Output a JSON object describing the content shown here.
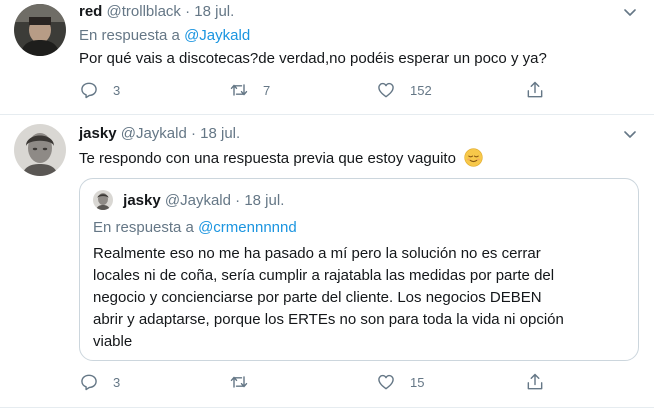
{
  "tweets": [
    {
      "display_name": "red",
      "handle": "@trollblack",
      "separator": "·",
      "date": "18 jul.",
      "reply_prefix": "En respuesta a",
      "reply_mention": "@Jaykald",
      "text": "Por qué vais a discotecas?de verdad,no podéis esperar un poco y ya?",
      "replies": "3",
      "retweets": "7",
      "likes": "152"
    },
    {
      "display_name": "jasky",
      "handle": "@Jaykald",
      "separator": "·",
      "date": "18 jul.",
      "text": "Te respondo con una respuesta previa que estoy vaguito",
      "emoji": "relieved-face-emoji",
      "replies": "3",
      "retweets": "",
      "likes": "15",
      "quoted": {
        "display_name": "jasky",
        "handle": "@Jaykald",
        "separator": "·",
        "date": "18 jul.",
        "reply_prefix": "En respuesta a",
        "reply_mention": "@crmennnnnd",
        "lines": [
          "Realmente eso no me ha pasado a mí pero la solución no es cerrar",
          "locales ni de coña, sería cumplir a rajatabla las medidas por parte del",
          "negocio y concienciarse por parte del cliente. Los negocios DEBEN",
          "abrir y adaptarse, porque los ERTEs no son para toda la vida ni opción",
          "viable"
        ]
      }
    }
  ],
  "icons": [
    "chevron-down-icon",
    "reply-icon",
    "retweet-icon",
    "like-icon",
    "share-icon"
  ],
  "colors": {
    "text": "#14171a",
    "secondary": "#657786",
    "link": "#1b95e0",
    "border": "#ccd6dd",
    "divider": "#e6ecf0"
  }
}
